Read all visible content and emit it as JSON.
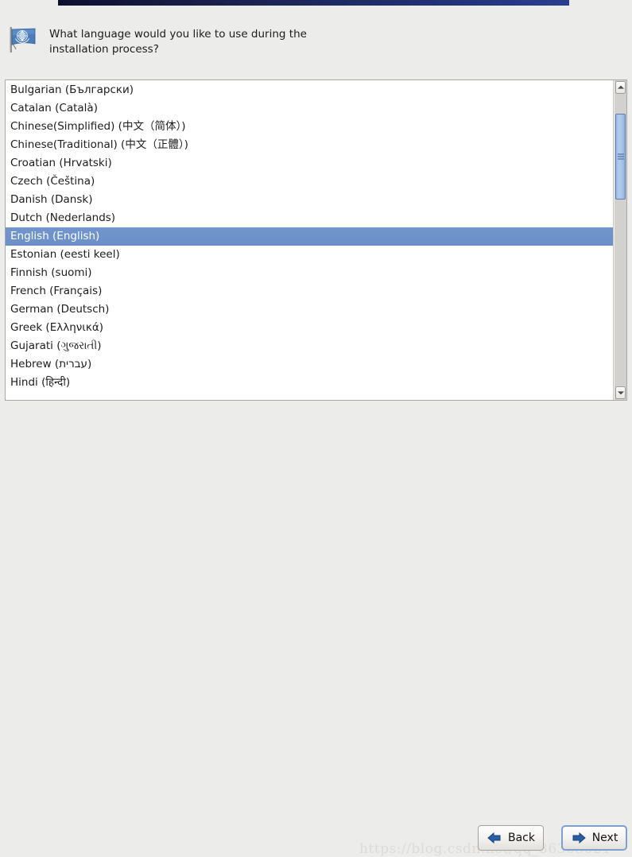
{
  "window": {
    "accent_bar_color": "#1e2a63",
    "background_color": "#ececeb"
  },
  "header": {
    "icon": "un-flag-icon",
    "prompt": "What language would you like to use during the\ninstallation process?"
  },
  "language_list": {
    "name": "language-list",
    "selected_index": 8,
    "selection_color": "#6e92cb",
    "items": [
      "Bulgarian (Български)",
      "Catalan (Català)",
      "Chinese(Simplified) (中文（简体）)",
      "Chinese(Traditional) (中文（正體）)",
      "Croatian (Hrvatski)",
      "Czech (Čeština)",
      "Danish (Dansk)",
      "Dutch (Nederlands)",
      "English (English)",
      "Estonian (eesti keel)",
      "Finnish (suomi)",
      "French (Français)",
      "German (Deutsch)",
      "Greek (Ελληνικά)",
      "Gujarati (ગુજરાતી)",
      "Hebrew (עברית)",
      "Hindi (हिन्दी)"
    ]
  },
  "scrollbar": {
    "up_arrow_icon": "chevron-up-icon",
    "down_arrow_icon": "chevron-down-icon",
    "thumb_grip_icon": "grip-lines-icon",
    "thumb_color": "#a2c0e9"
  },
  "footer": {
    "back_label": "Back",
    "back_icon": "arrow-left-icon",
    "next_label": "Next",
    "next_icon": "arrow-right-icon",
    "next_focused": true,
    "focus_color": "#7da1cd"
  },
  "watermark": {
    "text": "https://blog.csdn.net/qq_36363021"
  }
}
